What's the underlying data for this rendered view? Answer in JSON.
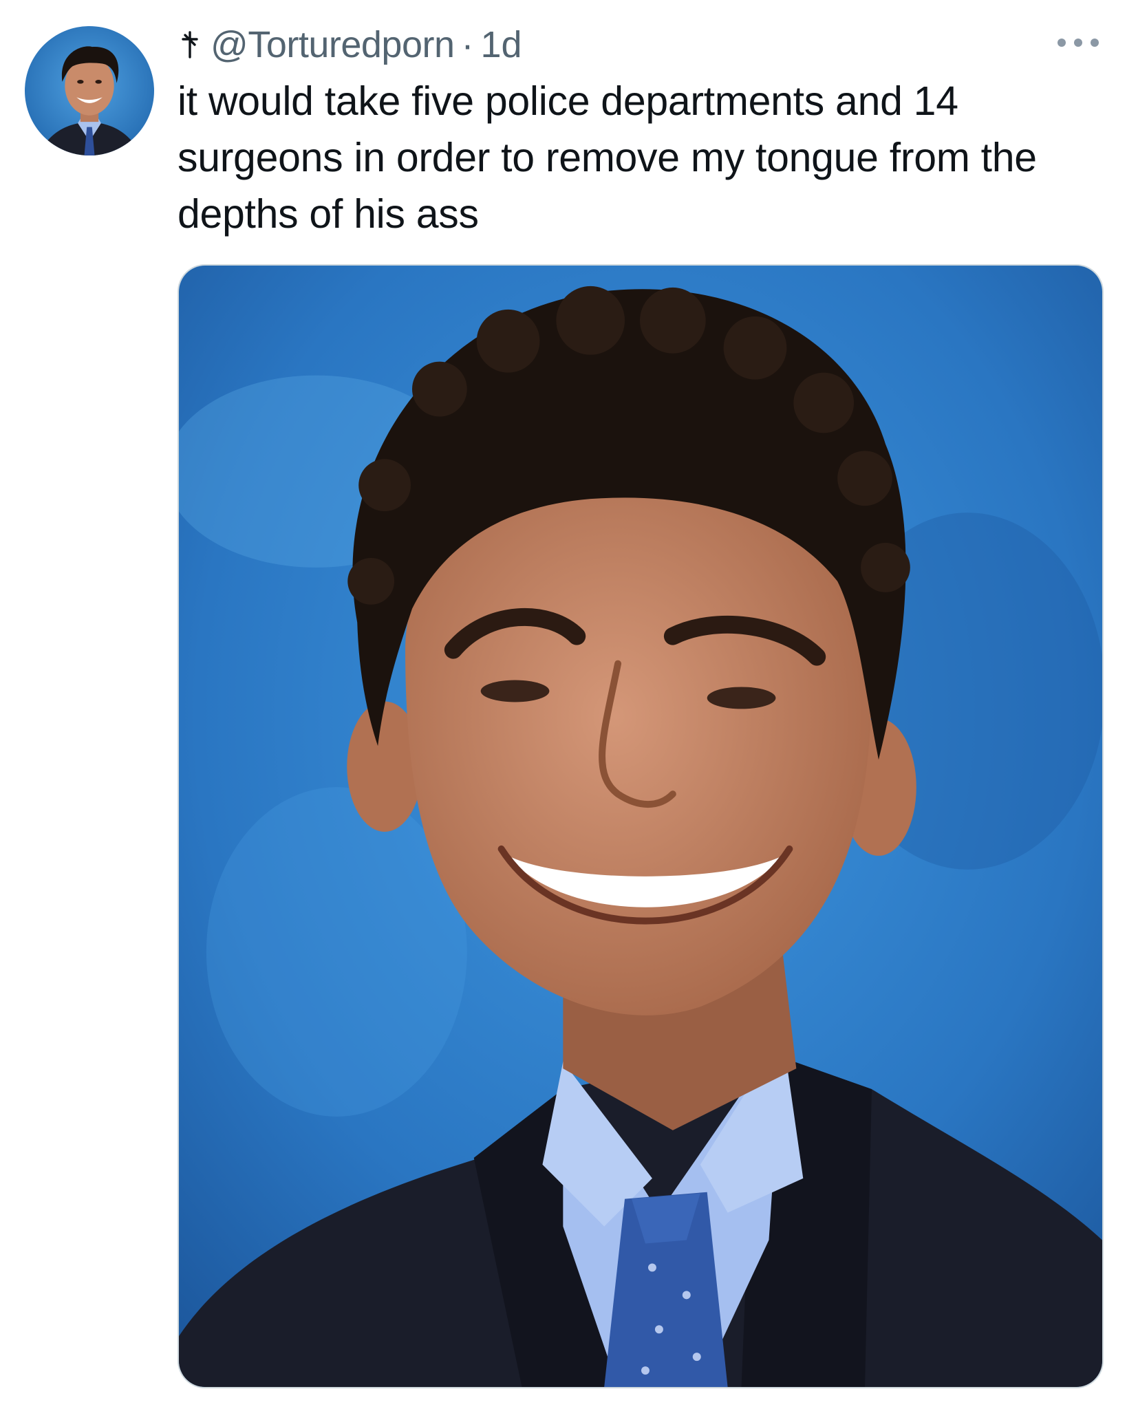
{
  "tweet": {
    "author_marker_icon": "cross-icon",
    "handle": "@Torturedporn",
    "separator": "·",
    "timestamp": "1d",
    "text": "it would take five police departments and 14 surgeons in order to remove my tongue from the depths of his ass",
    "more_icon": "more-horizontal-icon"
  },
  "colors": {
    "text_primary": "#0f1419",
    "text_secondary": "#536471",
    "photo_background": "#2f7fc8",
    "border": "#cfd9de"
  }
}
